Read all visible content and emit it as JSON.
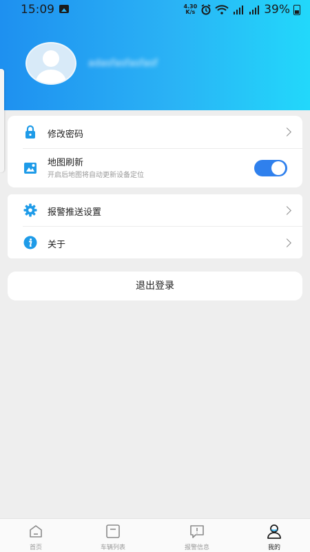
{
  "status_bar": {
    "time": "15:09",
    "net_speed_value": "4.30",
    "net_speed_unit": "K/s",
    "battery": "39%"
  },
  "profile": {
    "username": "adasfasfasfasf"
  },
  "settings_group_1": {
    "change_password": "修改密码",
    "map_refresh": "地图刷新",
    "map_refresh_desc": "开启后地图将自动更新设备定位",
    "map_refresh_enabled": true
  },
  "settings_group_2": {
    "alarm_push": "报警推送设置",
    "about": "关于"
  },
  "logout_label": "退出登录",
  "tabs": [
    {
      "label": "首页",
      "icon": "home-icon",
      "active": false
    },
    {
      "label": "车辆列表",
      "icon": "vehicle-list-icon",
      "active": false
    },
    {
      "label": "报警信息",
      "icon": "alarm-message-icon",
      "active": false
    },
    {
      "label": "我的",
      "icon": "profile-icon",
      "active": true
    }
  ],
  "colors": {
    "accent": "#2f80ed",
    "icon_blue": "#1e9be8",
    "header_start": "#1e90f0",
    "header_end": "#22d8fb"
  }
}
